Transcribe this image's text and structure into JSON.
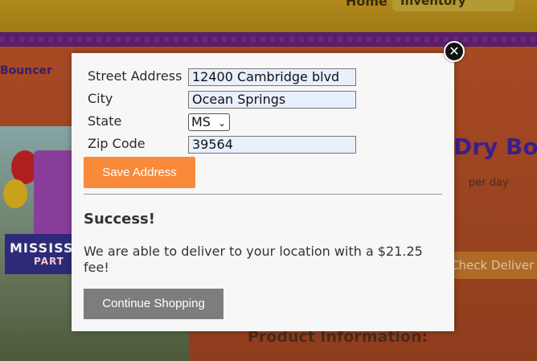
{
  "background": {
    "nav": {
      "home": "Home",
      "inventory": "Inventory"
    },
    "breadcrumb": "Bouncer",
    "product_title": "Dry Bo",
    "price_unit": "per day",
    "check_delivery": "Check Deliver",
    "product_info_heading": "Product Information:",
    "image_banner": {
      "line1": "MISSISSIP",
      "line2": "PART"
    }
  },
  "modal": {
    "close_glyph": "✕",
    "form": {
      "street": {
        "label": "Street Address",
        "value": "12400 Cambridge blvd"
      },
      "city": {
        "label": "City",
        "value": "Ocean Springs"
      },
      "state": {
        "label": "State",
        "value": "MS"
      },
      "zip": {
        "label": "Zip Code",
        "value": "39564"
      }
    },
    "save_button": "Save Address",
    "success_title": "Success!",
    "success_message": "We are able to deliver to your location with a $21.25 fee!",
    "continue_button": "Continue Shopping"
  },
  "colors": {
    "accent": "#f98a3a",
    "secondary_button": "#7d7d7d",
    "input_autofill": "#e8f0fe"
  }
}
